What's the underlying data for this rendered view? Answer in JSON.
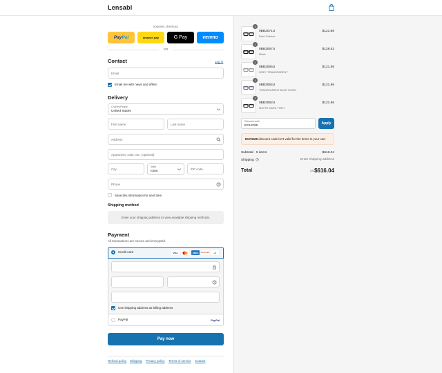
{
  "header": {
    "brand": "Lensabl",
    "cart_icon": "shopping-bag-icon"
  },
  "express": {
    "label": "Express checkout",
    "buttons": {
      "paypal_pay": "Pay",
      "paypal_pal": "Pal",
      "amazon": "amazon pay",
      "gpay": "G Pay",
      "venmo": "venmo"
    },
    "or": "OR"
  },
  "contact": {
    "title": "Contact",
    "login_link": "Log in",
    "email_placeholder": "Email",
    "newsletter_label": "Email me with news and offers",
    "newsletter_checked": true
  },
  "delivery": {
    "title": "Delivery",
    "country_label": "Country/Region",
    "country_value": "United States",
    "first_name_ph": "First name",
    "last_name_ph": "Last name",
    "address_ph": "Address",
    "apartment_ph": "Apartment, suite, etc. (optional)",
    "city_ph": "City",
    "state_label": "State",
    "state_value": "Iowa",
    "zip_ph": "ZIP code",
    "phone_ph": "Phone",
    "save_info_label": "Save this information for next time",
    "save_info_checked": false
  },
  "shipping": {
    "title": "Shipping method",
    "notice": "Enter your shipping address to view available shipping methods."
  },
  "payment": {
    "title": "Payment",
    "subtitle": "All transactions are secure and encrypted.",
    "credit_card_label": "Credit card",
    "card_brands": [
      "VISA",
      "MC",
      "AMEX",
      "DISCOVER",
      "+4"
    ],
    "billing_same_label": "Use shipping address as billing address",
    "billing_same_checked": true,
    "paypal_label": "PayPal",
    "paypal_logo": "PayPal"
  },
  "pay_now_label": "Pay now",
  "footer_links": [
    "Refund policy",
    "Shipping",
    "Privacy policy",
    "Terms of service",
    "Contact"
  ],
  "order": {
    "items": [
      {
        "name": "0BB2071U",
        "variant": "Dark Tortoise",
        "price": "$121.86",
        "qty": "1"
      },
      {
        "name": "0BB2067U",
        "variant": "Black",
        "price": "$128.52",
        "qty": "1"
      },
      {
        "name": "0BB2065U",
        "variant": "GREY TRANSPARENT",
        "price": "$121.86",
        "qty": "1"
      },
      {
        "name": "0BB2064U",
        "variant": "TRANSPARENT BLUE HORN",
        "price": "$121.86",
        "qty": "1"
      },
      {
        "name": "0BB2062U",
        "variant": "MATTE DARK TORT",
        "price": "$121.86",
        "qty": "1"
      }
    ],
    "discount_label": "Discount code",
    "discount_value": "ECHO25",
    "apply_label": "Apply",
    "error_code": "ECHO25",
    "error_message": " discount code isn't valid for the items in your cart",
    "subtotal_label": "Subtotal · 5 items",
    "subtotal_value": "$616.04",
    "shipping_label": "Shipping",
    "shipping_value": "Enter shipping address",
    "total_label": "Total",
    "currency": "USD",
    "total_value": "$616.04"
  },
  "colors": {
    "accent": "#1773b0",
    "panel": "#f5f5f5",
    "error_bg": "#fcefe5"
  }
}
